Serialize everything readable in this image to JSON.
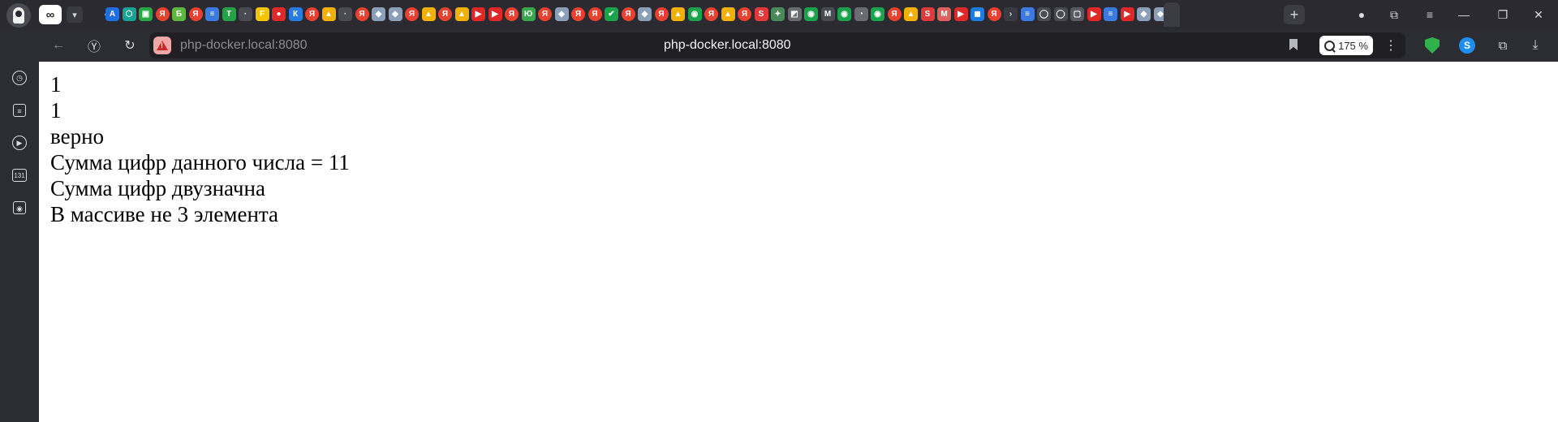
{
  "browser": {
    "address": {
      "url_display": "php-docker.local:8080",
      "url_centered": "php-docker.local:8080",
      "zoom": "175 %"
    },
    "tabgroup_label": "∞",
    "sidebar": {
      "badge_number": "131"
    },
    "favicons": [
      {
        "letter": "A",
        "color": "#1e6fe0"
      },
      {
        "letter": "⬡",
        "color": "#16a394"
      },
      {
        "letter": "▣",
        "color": "#28a745"
      },
      {
        "letter": "Я",
        "color": "#e8412f"
      },
      {
        "letter": "Б",
        "color": "#5fb640"
      },
      {
        "letter": "Я",
        "color": "#e8412f"
      },
      {
        "letter": "≡",
        "color": "#3b7ae0"
      },
      {
        "letter": "T",
        "color": "#27a046"
      },
      {
        "letter": "·",
        "color": "#4a4a52"
      },
      {
        "letter": "F",
        "color": "#f5c400"
      },
      {
        "letter": "●",
        "color": "#e02828"
      },
      {
        "letter": "К",
        "color": "#2a7be0"
      },
      {
        "letter": "Я",
        "color": "#e8412f"
      },
      {
        "letter": "▲",
        "color": "#f2b100"
      },
      {
        "letter": "·",
        "color": "#4a4a52"
      },
      {
        "letter": "Я",
        "color": "#e8412f"
      },
      {
        "letter": "◆",
        "color": "#8aa0b8"
      },
      {
        "letter": "◆",
        "color": "#8aa0b8"
      },
      {
        "letter": "Я",
        "color": "#e8412f"
      },
      {
        "letter": "▲",
        "color": "#f2b100"
      },
      {
        "letter": "Я",
        "color": "#e8412f"
      },
      {
        "letter": "▲",
        "color": "#f2b100"
      },
      {
        "letter": "▶",
        "color": "#e02828"
      },
      {
        "letter": "▶",
        "color": "#e02828"
      },
      {
        "letter": "Я",
        "color": "#e8412f"
      },
      {
        "letter": "Ю",
        "color": "#3aa84a"
      },
      {
        "letter": "Я",
        "color": "#e8412f"
      },
      {
        "letter": "◆",
        "color": "#8aa0b8"
      },
      {
        "letter": "Я",
        "color": "#e8412f"
      },
      {
        "letter": "Я",
        "color": "#e8412f"
      },
      {
        "letter": "✔",
        "color": "#1aa34a"
      },
      {
        "letter": "Я",
        "color": "#e8412f"
      },
      {
        "letter": "◆",
        "color": "#8aa0b8"
      },
      {
        "letter": "Я",
        "color": "#e8412f"
      },
      {
        "letter": "▲",
        "color": "#f2b100"
      },
      {
        "letter": "◉",
        "color": "#1aa34a"
      },
      {
        "letter": "Я",
        "color": "#e8412f"
      },
      {
        "letter": "▲",
        "color": "#f2b100"
      },
      {
        "letter": "Я",
        "color": "#e8412f"
      },
      {
        "letter": "S",
        "color": "#e03a3a"
      },
      {
        "letter": "✦",
        "color": "#4a8a5a"
      },
      {
        "letter": "◩",
        "color": "#6a6a72"
      },
      {
        "letter": "◉",
        "color": "#1aa34a"
      },
      {
        "letter": "М",
        "color": "#4a4a52"
      },
      {
        "letter": "◉",
        "color": "#1aa34a"
      },
      {
        "letter": "◔",
        "color": "#6a6a72"
      },
      {
        "letter": "◉",
        "color": "#1aa34a"
      },
      {
        "letter": "Я",
        "color": "#e8412f"
      },
      {
        "letter": "▲",
        "color": "#f2b100"
      },
      {
        "letter": "S",
        "color": "#e03a3a"
      },
      {
        "letter": "M",
        "color": "#e06060"
      },
      {
        "letter": "▶",
        "color": "#e02828"
      },
      {
        "letter": "◼",
        "color": "#1e7be0"
      },
      {
        "letter": "Я",
        "color": "#e8412f"
      },
      {
        "letter": "›",
        "color": "#3a3a42"
      },
      {
        "letter": "≡",
        "color": "#3b7ae0"
      },
      {
        "letter": "◯",
        "color": "#4a4a52"
      },
      {
        "letter": "◯",
        "color": "#4a4a52"
      },
      {
        "letter": "▢",
        "color": "#5a5a62"
      },
      {
        "letter": "▶",
        "color": "#e02828"
      },
      {
        "letter": "≡",
        "color": "#3b7ae0"
      },
      {
        "letter": "▶",
        "color": "#e02828"
      },
      {
        "letter": "◆",
        "color": "#8aa0b8"
      },
      {
        "letter": "◆",
        "color": "#8aa0b8"
      }
    ]
  },
  "page": {
    "lines": [
      "1",
      "1",
      "верно",
      "Сумма цифр данного числа = 11",
      "Сумма цифр двузначна",
      "В массиве не 3 элемента"
    ]
  }
}
